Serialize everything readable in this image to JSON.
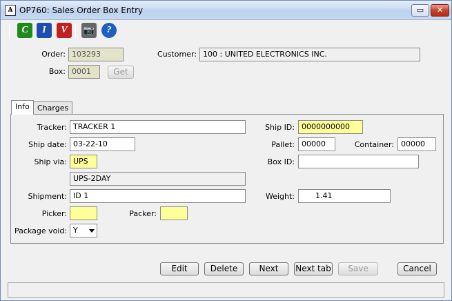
{
  "window": {
    "title": "OP760: Sales Order Box Entry",
    "app_icon_text": "Ѧ"
  },
  "toolbar": {
    "icons": [
      {
        "name": "c-icon",
        "glyph": "C",
        "color": "#1e8a1e"
      },
      {
        "name": "i-icon",
        "glyph": "I",
        "color": "#1e4fb0"
      },
      {
        "name": "v-icon",
        "glyph": "V",
        "color": "#c02020"
      },
      {
        "name": "camera-icon",
        "glyph": "📷",
        "color": "#666666"
      },
      {
        "name": "help-icon",
        "glyph": "?",
        "color": "#1f5fbf"
      }
    ]
  },
  "header": {
    "order_label": "Order:",
    "order_value": "103293",
    "customer_label": "Customer:",
    "customer_value": "100      : UNITED ELECTRONICS INC.",
    "box_label": "Box:",
    "box_value": "0001",
    "get_label": "Get"
  },
  "tabs": [
    {
      "label": "Info"
    },
    {
      "label": "Charges"
    }
  ],
  "info": {
    "tracker_label": "Tracker:",
    "tracker_value": "TRACKER 1",
    "ship_date_label": "Ship date:",
    "ship_date_value": "03-22-10",
    "ship_via_label": "Ship via:",
    "ship_via_value": "UPS",
    "ship_via_desc": "UPS-2DAY",
    "shipment_label": "Shipment:",
    "shipment_value": "ID 1",
    "picker_label": "Picker:",
    "picker_value": "",
    "packer_label": "Packer:",
    "packer_value": "",
    "package_void_label": "Package void:",
    "package_void_value": "Y",
    "ship_id_label": "Ship ID:",
    "ship_id_value": "0000000000",
    "pallet_label": "Pallet:",
    "pallet_value": "00000",
    "container_label": "Container:",
    "container_value": "00000",
    "box_id_label": "Box ID:",
    "box_id_value": "",
    "weight_label": "Weight:",
    "weight_value": "1.41"
  },
  "buttons": {
    "edit": "Edit",
    "delete": "Delete",
    "next": "Next",
    "next_tab": "Next tab",
    "save": "Save",
    "cancel": "Cancel"
  },
  "window_controls": {
    "restore": "▭",
    "close": "✕"
  }
}
